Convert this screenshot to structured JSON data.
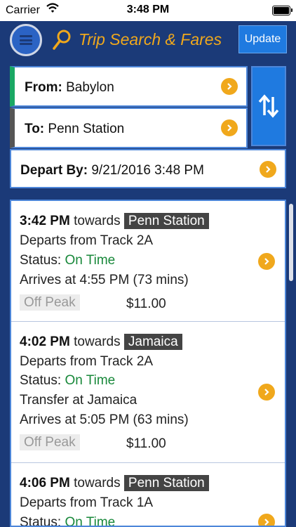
{
  "status_bar": {
    "carrier": "Carrier",
    "time": "3:48 PM"
  },
  "header": {
    "title": "Trip Search & Fares",
    "update_label": "Update"
  },
  "trip": {
    "from_label": "From:",
    "from_value": "Babylon",
    "to_label": "To:",
    "to_value": "Penn Station",
    "depart_label": "Depart By:",
    "depart_value": "9/21/2016 3:48 PM"
  },
  "results": [
    {
      "time": "3:42 PM",
      "towards": "towards",
      "destination": "Penn Station",
      "track": "Departs from Track 2A",
      "status_label": "Status:",
      "status_value": "On Time",
      "arrives": "Arrives at 4:55 PM (73 mins)",
      "peak": "Off Peak",
      "fare": "$11.00"
    },
    {
      "time": "4:02 PM",
      "towards": "towards",
      "destination": "Jamaica",
      "track": "Departs from Track 2A",
      "status_label": "Status:",
      "status_value": "On Time",
      "transfer": "Transfer at Jamaica",
      "arrives": "Arrives at 5:05 PM (63 mins)",
      "peak": "Off Peak",
      "fare": "$11.00"
    },
    {
      "time": "4:06 PM",
      "towards": "towards",
      "destination": "Penn Station",
      "track": "Departs from Track 1A",
      "status_label": "Status:",
      "status_value": "On Time"
    }
  ],
  "colors": {
    "accent": "#f0a81c",
    "nav_bg": "#1b3a78",
    "button_blue": "#1f7ae0",
    "on_time": "#18883a"
  }
}
